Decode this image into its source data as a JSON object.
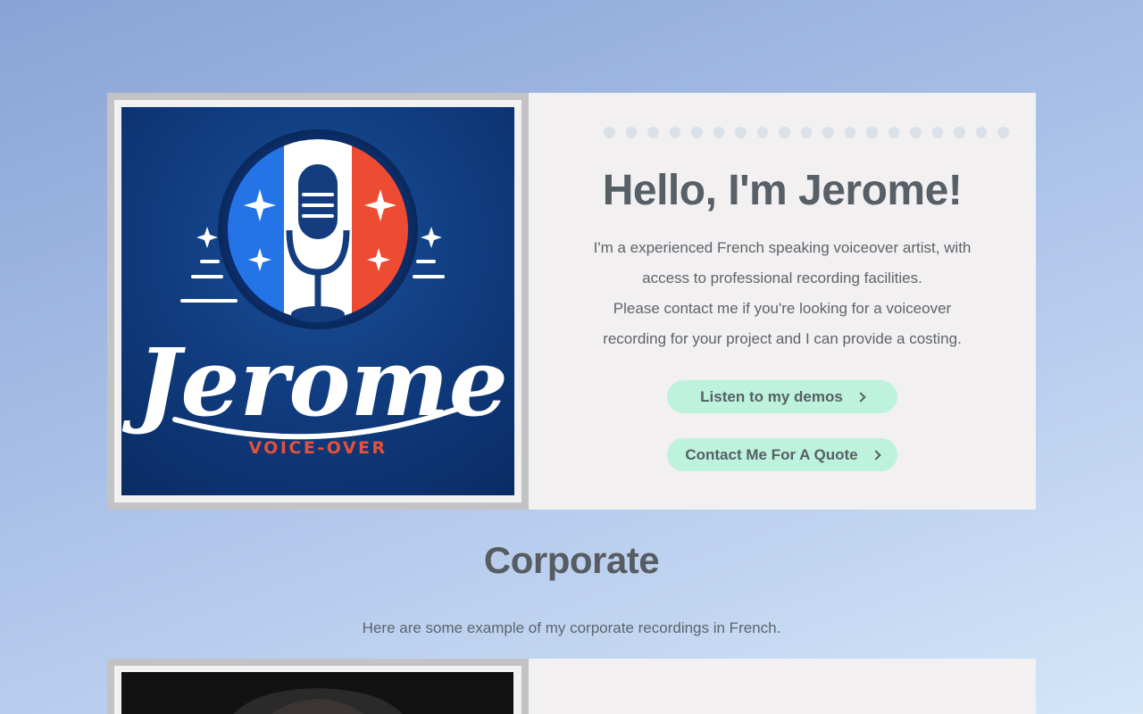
{
  "hero": {
    "logo": {
      "wordmark": "Jerome",
      "tagline": "VOICE-OVER",
      "colors": {
        "background": "#0f3a7c",
        "flag_blue": "#1f6fe0",
        "flag_white": "#ffffff",
        "flag_red": "#e84a33",
        "tagline": "#e8503a"
      },
      "icon": "microphone-icon"
    },
    "title": "Hello, I'm Jerome!",
    "description_line1": "I'm a experienced French speaking voiceover artist, with access to professional recording facilities.",
    "description_line2": "Please contact me if you're looking for a voiceover recording for your project and I can provide a costing.",
    "buttons": {
      "demos_label": "Listen to my demos",
      "quote_label": "Contact Me For A Quote"
    },
    "accent_color": "#bdf2dc"
  },
  "corporate": {
    "title": "Corporate",
    "description": "Here are some example of my corporate recordings in French."
  }
}
